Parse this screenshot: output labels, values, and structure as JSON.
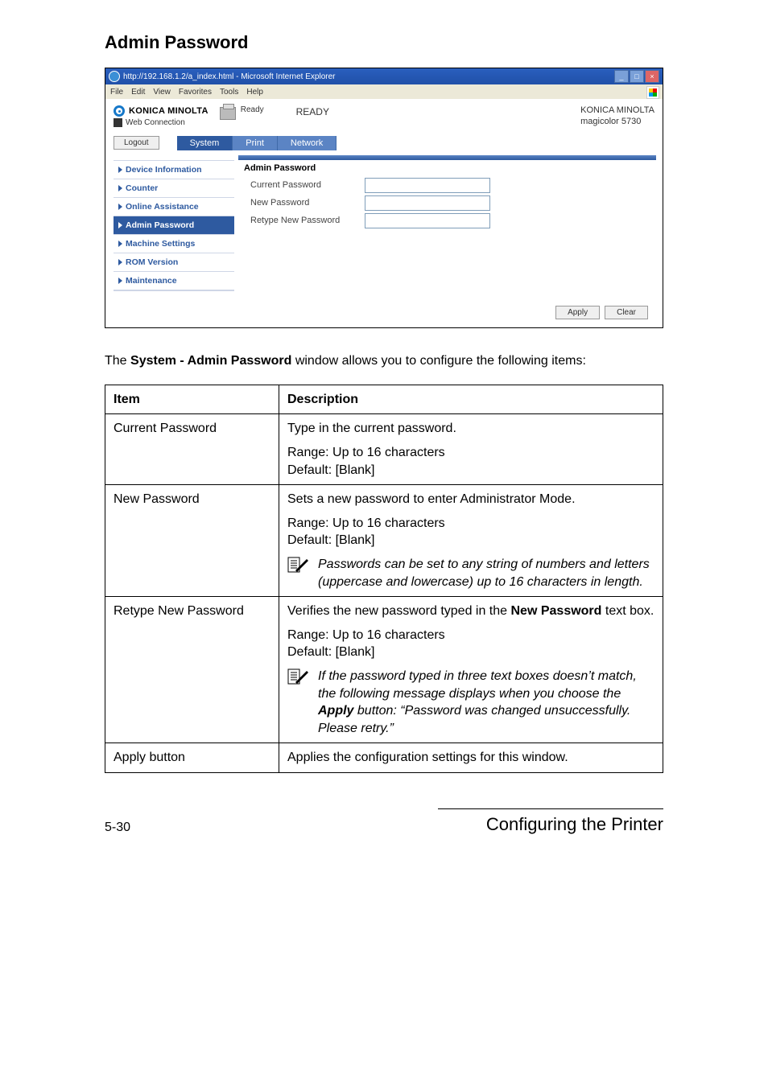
{
  "section_title": "Admin Password",
  "screenshot": {
    "ie_title": "http://192.168.1.2/a_index.html - Microsoft Internet Explorer",
    "menu": [
      "File",
      "Edit",
      "View",
      "Favorites",
      "Tools",
      "Help"
    ],
    "brand": "KONICA MINOLTA",
    "pagescope": "Web Connection",
    "ready_small": "Ready",
    "ready_big": "READY",
    "device_brand": "KONICA MINOLTA",
    "device_model": "magicolor 5730",
    "logout": "Logout",
    "tabs": {
      "system": "System",
      "print": "Print",
      "network": "Network"
    },
    "sidebar": [
      {
        "label": "Device Information",
        "selected": false
      },
      {
        "label": "Counter",
        "selected": false
      },
      {
        "label": "Online Assistance",
        "selected": false
      },
      {
        "label": "Admin Password",
        "selected": true
      },
      {
        "label": "Machine Settings",
        "selected": false
      },
      {
        "label": "ROM Version",
        "selected": false
      },
      {
        "label": "Maintenance",
        "selected": false
      }
    ],
    "form_title": "Admin Password",
    "fields": {
      "current": "Current Password",
      "new": "New Password",
      "retype": "Retype New Password"
    },
    "buttons": {
      "apply": "Apply",
      "clear": "Clear"
    }
  },
  "intro_pre": "The ",
  "intro_bold": "System - Admin Password",
  "intro_post": " window allows you to configure the following items:",
  "table": {
    "head_item": "Item",
    "head_desc": "Description",
    "rows": {
      "current": {
        "item": "Current Password",
        "line1": "Type in the current password.",
        "range": "Range:   Up to 16 characters",
        "default": "Default:   [Blank]"
      },
      "new": {
        "item": "New Password",
        "line1": "Sets a new password to enter Administrator Mode.",
        "range": "Range:   Up to 16 characters",
        "default": "Default:   [Blank]",
        "note": "Passwords can be set to any string of numbers and letters (uppercase and lowercase) up to 16 characters in length."
      },
      "retype": {
        "item": "Retype New Password",
        "line1_pre": "Verifies the new password typed in the ",
        "line1_bold": "New Password",
        "line1_post": " text box.",
        "range": "Range:   Up to 16 characters",
        "default": "Default:   [Blank]",
        "note_pre": "If the password typed in three text boxes doesn’t match, the following message displays when you choose the ",
        "note_bold": "Apply",
        "note_post": " button: “Password was changed unsuccessfully. Please retry.”"
      },
      "apply": {
        "item": "Apply button",
        "line1": "Applies the configuration settings for this window."
      }
    }
  },
  "footer": {
    "page": "5-30",
    "title": "Configuring the Printer"
  }
}
